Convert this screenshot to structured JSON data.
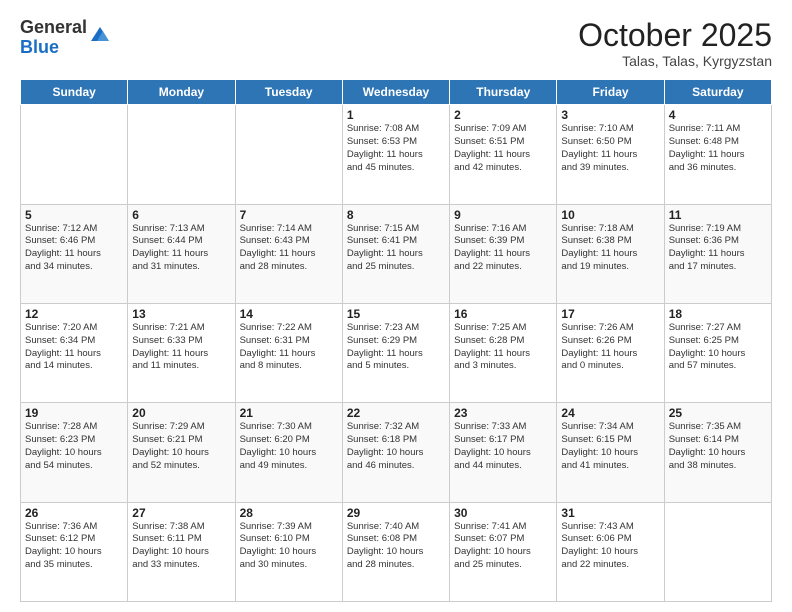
{
  "header": {
    "logo_general": "General",
    "logo_blue": "Blue",
    "month": "October 2025",
    "location": "Talas, Talas, Kyrgyzstan"
  },
  "days_of_week": [
    "Sunday",
    "Monday",
    "Tuesday",
    "Wednesday",
    "Thursday",
    "Friday",
    "Saturday"
  ],
  "weeks": [
    [
      {
        "num": "",
        "info": ""
      },
      {
        "num": "",
        "info": ""
      },
      {
        "num": "",
        "info": ""
      },
      {
        "num": "1",
        "info": "Sunrise: 7:08 AM\nSunset: 6:53 PM\nDaylight: 11 hours\nand 45 minutes."
      },
      {
        "num": "2",
        "info": "Sunrise: 7:09 AM\nSunset: 6:51 PM\nDaylight: 11 hours\nand 42 minutes."
      },
      {
        "num": "3",
        "info": "Sunrise: 7:10 AM\nSunset: 6:50 PM\nDaylight: 11 hours\nand 39 minutes."
      },
      {
        "num": "4",
        "info": "Sunrise: 7:11 AM\nSunset: 6:48 PM\nDaylight: 11 hours\nand 36 minutes."
      }
    ],
    [
      {
        "num": "5",
        "info": "Sunrise: 7:12 AM\nSunset: 6:46 PM\nDaylight: 11 hours\nand 34 minutes."
      },
      {
        "num": "6",
        "info": "Sunrise: 7:13 AM\nSunset: 6:44 PM\nDaylight: 11 hours\nand 31 minutes."
      },
      {
        "num": "7",
        "info": "Sunrise: 7:14 AM\nSunset: 6:43 PM\nDaylight: 11 hours\nand 28 minutes."
      },
      {
        "num": "8",
        "info": "Sunrise: 7:15 AM\nSunset: 6:41 PM\nDaylight: 11 hours\nand 25 minutes."
      },
      {
        "num": "9",
        "info": "Sunrise: 7:16 AM\nSunset: 6:39 PM\nDaylight: 11 hours\nand 22 minutes."
      },
      {
        "num": "10",
        "info": "Sunrise: 7:18 AM\nSunset: 6:38 PM\nDaylight: 11 hours\nand 19 minutes."
      },
      {
        "num": "11",
        "info": "Sunrise: 7:19 AM\nSunset: 6:36 PM\nDaylight: 11 hours\nand 17 minutes."
      }
    ],
    [
      {
        "num": "12",
        "info": "Sunrise: 7:20 AM\nSunset: 6:34 PM\nDaylight: 11 hours\nand 14 minutes."
      },
      {
        "num": "13",
        "info": "Sunrise: 7:21 AM\nSunset: 6:33 PM\nDaylight: 11 hours\nand 11 minutes."
      },
      {
        "num": "14",
        "info": "Sunrise: 7:22 AM\nSunset: 6:31 PM\nDaylight: 11 hours\nand 8 minutes."
      },
      {
        "num": "15",
        "info": "Sunrise: 7:23 AM\nSunset: 6:29 PM\nDaylight: 11 hours\nand 5 minutes."
      },
      {
        "num": "16",
        "info": "Sunrise: 7:25 AM\nSunset: 6:28 PM\nDaylight: 11 hours\nand 3 minutes."
      },
      {
        "num": "17",
        "info": "Sunrise: 7:26 AM\nSunset: 6:26 PM\nDaylight: 11 hours\nand 0 minutes."
      },
      {
        "num": "18",
        "info": "Sunrise: 7:27 AM\nSunset: 6:25 PM\nDaylight: 10 hours\nand 57 minutes."
      }
    ],
    [
      {
        "num": "19",
        "info": "Sunrise: 7:28 AM\nSunset: 6:23 PM\nDaylight: 10 hours\nand 54 minutes."
      },
      {
        "num": "20",
        "info": "Sunrise: 7:29 AM\nSunset: 6:21 PM\nDaylight: 10 hours\nand 52 minutes."
      },
      {
        "num": "21",
        "info": "Sunrise: 7:30 AM\nSunset: 6:20 PM\nDaylight: 10 hours\nand 49 minutes."
      },
      {
        "num": "22",
        "info": "Sunrise: 7:32 AM\nSunset: 6:18 PM\nDaylight: 10 hours\nand 46 minutes."
      },
      {
        "num": "23",
        "info": "Sunrise: 7:33 AM\nSunset: 6:17 PM\nDaylight: 10 hours\nand 44 minutes."
      },
      {
        "num": "24",
        "info": "Sunrise: 7:34 AM\nSunset: 6:15 PM\nDaylight: 10 hours\nand 41 minutes."
      },
      {
        "num": "25",
        "info": "Sunrise: 7:35 AM\nSunset: 6:14 PM\nDaylight: 10 hours\nand 38 minutes."
      }
    ],
    [
      {
        "num": "26",
        "info": "Sunrise: 7:36 AM\nSunset: 6:12 PM\nDaylight: 10 hours\nand 35 minutes."
      },
      {
        "num": "27",
        "info": "Sunrise: 7:38 AM\nSunset: 6:11 PM\nDaylight: 10 hours\nand 33 minutes."
      },
      {
        "num": "28",
        "info": "Sunrise: 7:39 AM\nSunset: 6:10 PM\nDaylight: 10 hours\nand 30 minutes."
      },
      {
        "num": "29",
        "info": "Sunrise: 7:40 AM\nSunset: 6:08 PM\nDaylight: 10 hours\nand 28 minutes."
      },
      {
        "num": "30",
        "info": "Sunrise: 7:41 AM\nSunset: 6:07 PM\nDaylight: 10 hours\nand 25 minutes."
      },
      {
        "num": "31",
        "info": "Sunrise: 7:43 AM\nSunset: 6:06 PM\nDaylight: 10 hours\nand 22 minutes."
      },
      {
        "num": "",
        "info": ""
      }
    ]
  ]
}
